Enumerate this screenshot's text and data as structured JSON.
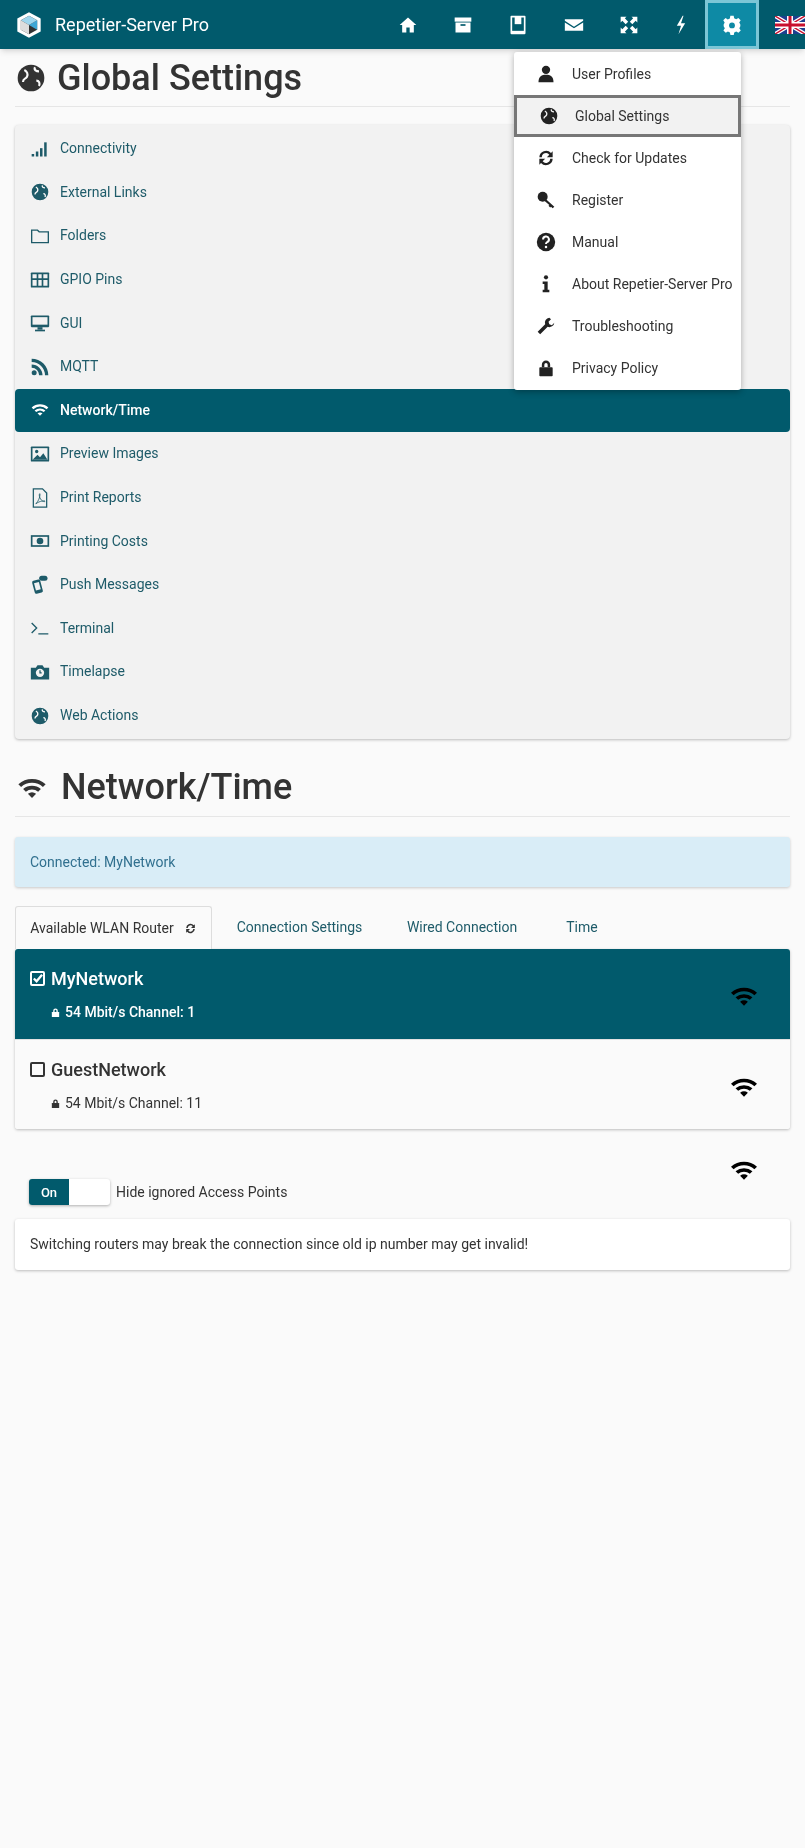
{
  "app": {
    "title": "Repetier-Server Pro"
  },
  "nav_buttons": [
    {
      "selected": false
    },
    {
      "selected": false
    },
    {
      "selected": false
    },
    {
      "selected": false
    },
    {
      "selected": false
    },
    {
      "selected": false
    },
    {
      "selected": true
    }
  ],
  "page_title": "Global Settings",
  "settings_menu": [
    {
      "label": "Connectivity",
      "selected": false
    },
    {
      "label": "External Links",
      "selected": false
    },
    {
      "label": "Folders",
      "selected": false
    },
    {
      "label": "GPIO Pins",
      "selected": false
    },
    {
      "label": "GUI",
      "selected": false
    },
    {
      "label": "MQTT",
      "selected": false
    },
    {
      "label": "Network/Time",
      "selected": true
    },
    {
      "label": "Preview Images",
      "selected": false
    },
    {
      "label": "Print Reports",
      "selected": false
    },
    {
      "label": "Printing Costs",
      "selected": false
    },
    {
      "label": "Push Messages",
      "selected": false
    },
    {
      "label": "Terminal",
      "selected": false
    },
    {
      "label": "Timelapse",
      "selected": false
    },
    {
      "label": "Web Actions",
      "selected": false
    }
  ],
  "section_title": "Network/Time",
  "alert": "Connected: MyNetwork",
  "tabs": [
    {
      "label": "Available WLAN Router",
      "selected": true
    },
    {
      "label": "Connection Settings",
      "selected": false
    },
    {
      "label": "Wired Connection",
      "selected": false
    },
    {
      "label": "Time",
      "selected": false
    }
  ],
  "networks": [
    {
      "name": "MyNetwork",
      "info": "54 Mbit/s Channel: 1",
      "selected": true
    },
    {
      "name": "GuestNetwork",
      "info": "54 Mbit/s Channel: 11",
      "selected": false
    }
  ],
  "toggle": {
    "state_label": "On",
    "on": true,
    "label": "Hide ignored Access Points"
  },
  "note": "Switching routers may break the connection since old ip number may get invalid!",
  "dropdown": [
    {
      "label": "User Profiles",
      "selected": false
    },
    {
      "label": "Global Settings",
      "selected": true
    },
    {
      "label": "Check for Updates",
      "selected": false
    },
    {
      "label": "Register",
      "selected": false
    },
    {
      "label": "Manual",
      "selected": false
    },
    {
      "label": "About Repetier-Server Pro",
      "selected": false
    },
    {
      "label": "Troubleshooting",
      "selected": false
    },
    {
      "label": "Privacy Policy",
      "selected": false
    }
  ]
}
